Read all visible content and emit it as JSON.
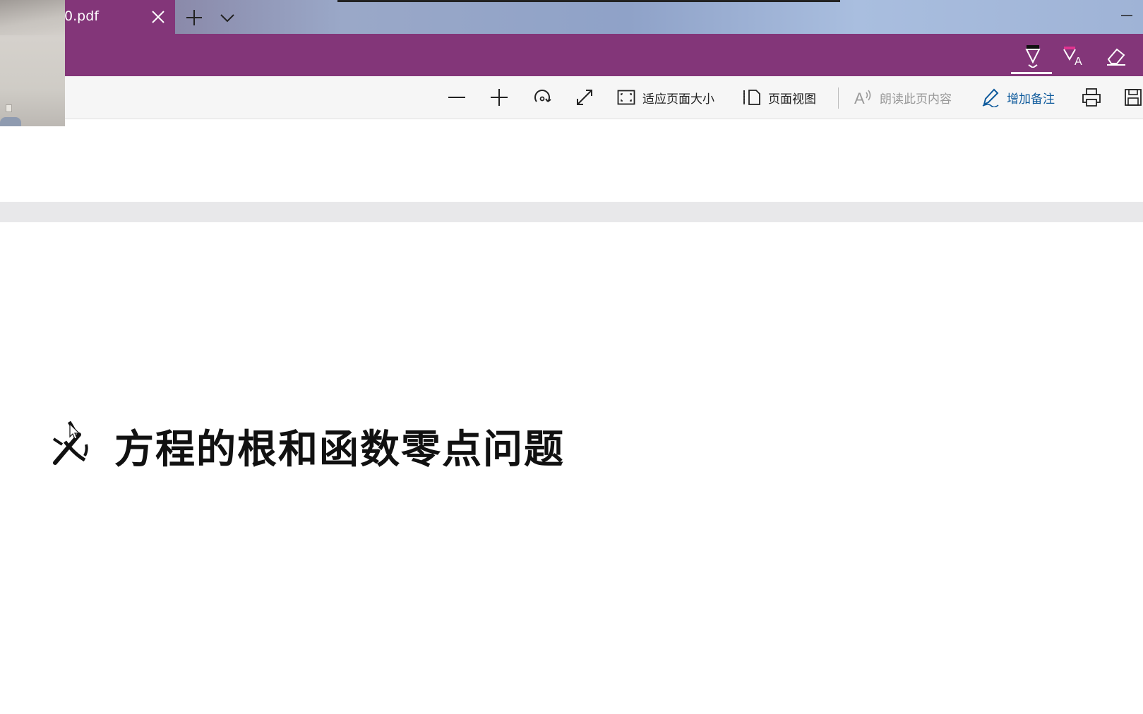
{
  "tab": {
    "title": "0.pdf"
  },
  "ink_toolbar": {
    "tools": [
      {
        "name": "pen",
        "icon": "pen-icon",
        "selected": true
      },
      {
        "name": "text-highlight",
        "icon": "highlight-text-icon"
      },
      {
        "name": "eraser",
        "icon": "eraser-icon"
      }
    ]
  },
  "toolbar": {
    "fit_page_label": "适应页面大小",
    "page_view_label": "页面视图",
    "read_aloud_label": "朗读此页内容",
    "add_notes_label": "增加备注"
  },
  "document": {
    "heading": "方程的根和函数零点问题"
  },
  "colors": {
    "accent": "#833679",
    "toolbar_bg": "#f6f6f6",
    "link_blue": "#0e5a9c"
  }
}
